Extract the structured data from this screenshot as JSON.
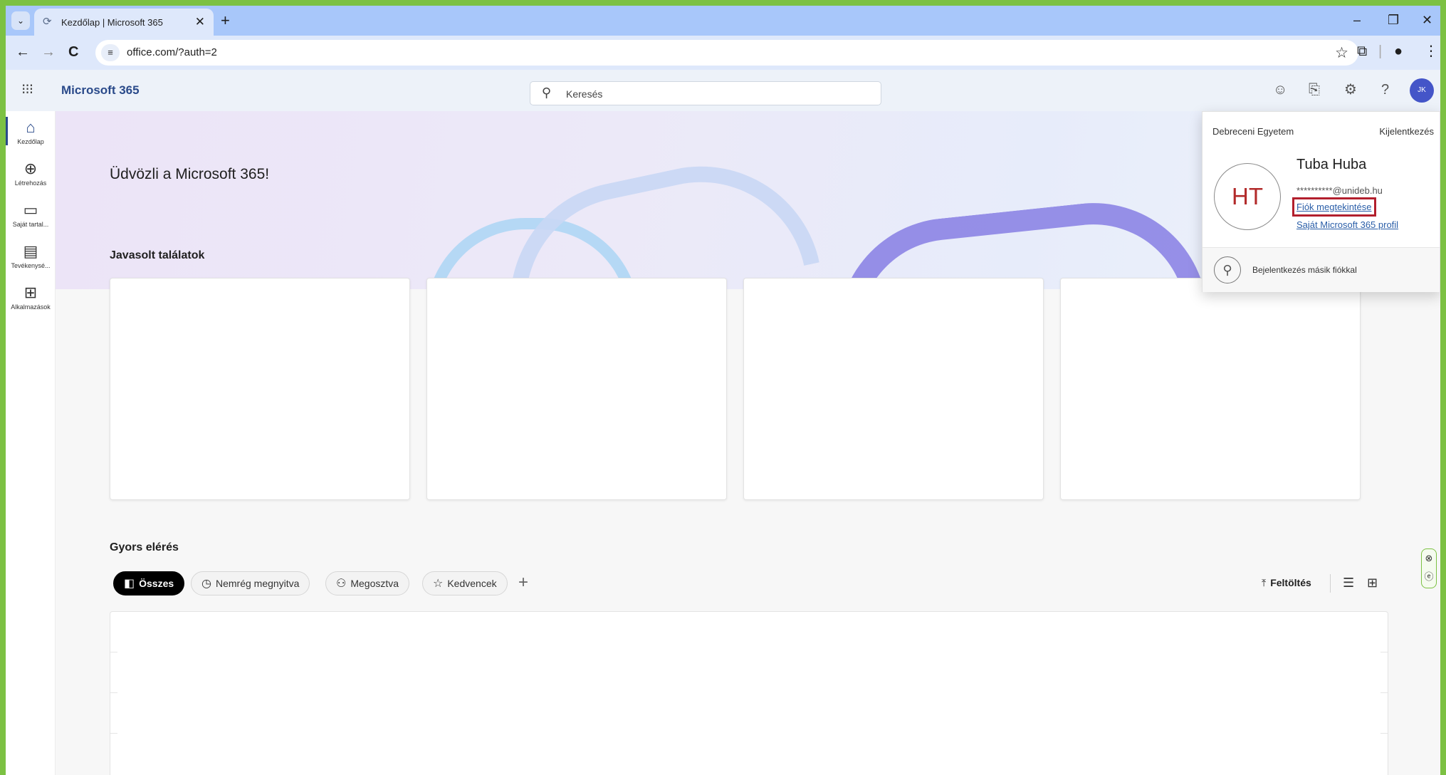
{
  "browser": {
    "tab_title": "Kezdőlap | Microsoft 365",
    "tab_close": "✕",
    "new_tab": "+",
    "url": "office.com/?auth=2",
    "win_minimize": "–",
    "win_restore": "❐",
    "win_close": "✕"
  },
  "header": {
    "app_name": "Microsoft 365",
    "search_placeholder": "Keresés",
    "avatar_initials": "JK"
  },
  "rail": {
    "items": [
      {
        "label": "Kezdőlap"
      },
      {
        "label": "Létrehozás"
      },
      {
        "label": "Saját tartal..."
      },
      {
        "label": "Tevékenysé..."
      },
      {
        "label": "Alkalmazások"
      }
    ]
  },
  "main": {
    "welcome": "Üdvözli a Microsoft 365!",
    "suggested_title": "Javasolt találatok",
    "quick_access_title": "Gyors elérés",
    "filters": [
      {
        "label": "Összes",
        "active": true
      },
      {
        "label": "Nemrég megnyitva"
      },
      {
        "label": "Megosztva"
      },
      {
        "label": "Kedvencek"
      }
    ],
    "upload_label": "Feltöltés"
  },
  "account": {
    "org": "Debreceni Egyetem",
    "sign_out": "Kijelentkezés",
    "initials": "HT",
    "name": "Tuba Huba",
    "email": "**********@unideb.hu",
    "view_account": "Fiók megtekintése",
    "profile_link": "Saját Microsoft 365 profil",
    "other_account": "Bejelentkezés másik fiókkal"
  },
  "colors": {
    "accent": "#2a4a8a",
    "highlight_box": "#b21f2d",
    "browser_tabstrip": "#a8c7fa"
  }
}
